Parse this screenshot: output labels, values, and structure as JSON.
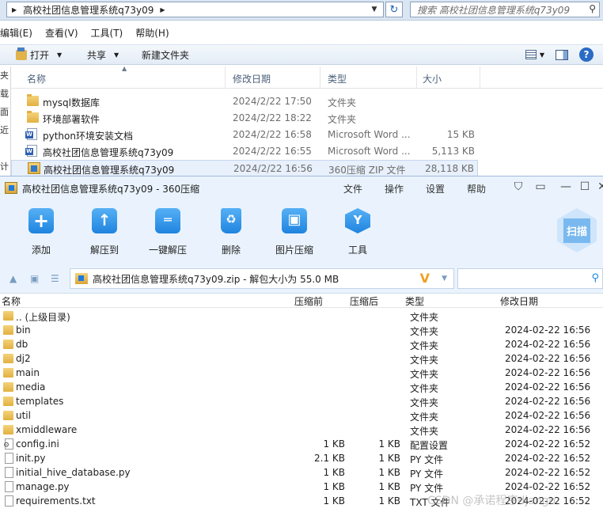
{
  "explorer": {
    "breadcrumb": "高校社团信息管理系统q73y09",
    "search_placeholder": "搜索 高校社团信息管理系统q73y09",
    "menu": [
      "编辑(E)",
      "查看(V)",
      "工具(T)",
      "帮助(H)"
    ],
    "commands": {
      "open": "打开",
      "share": "共享",
      "new_folder": "新建文件夹"
    },
    "left_strip": [
      "夹",
      "载",
      "面",
      "近访",
      "",
      "计"
    ],
    "columns": {
      "name": "名称",
      "date": "修改日期",
      "type": "类型",
      "size": "大小"
    },
    "files": [
      {
        "icon": "folder",
        "name": "mysql数据库",
        "date": "2024/2/22 17:50",
        "type": "文件夹",
        "size": ""
      },
      {
        "icon": "folder",
        "name": "环境部署软件",
        "date": "2024/2/22 18:22",
        "type": "文件夹",
        "size": ""
      },
      {
        "icon": "word",
        "name": "python环境安装文档",
        "date": "2024/2/22 16:58",
        "type": "Microsoft Word ...",
        "size": "15 KB"
      },
      {
        "icon": "word",
        "name": "高校社团信息管理系统q73y09",
        "date": "2024/2/22 16:55",
        "type": "Microsoft Word ...",
        "size": "5,113 KB"
      },
      {
        "icon": "zip",
        "name": "高校社团信息管理系统q73y09",
        "date": "2024/2/22 16:56",
        "type": "360压缩 ZIP 文件",
        "size": "28,118 KB"
      }
    ]
  },
  "zip": {
    "title": "高校社团信息管理系统q73y09 - 360压缩",
    "menu": [
      "文件",
      "操作",
      "设置",
      "帮助"
    ],
    "toolbar": [
      "添加",
      "解压到",
      "一键解压",
      "删除",
      "图片压缩",
      "工具"
    ],
    "scan_label": "扫描",
    "path": "高校社团信息管理系统q73y09.zip - 解包大小为 55.0 MB",
    "columns": {
      "name": "名称",
      "compressed": "压缩前",
      "packed": "压缩后",
      "type": "类型",
      "date": "修改日期"
    },
    "entries": [
      {
        "icon": "folder",
        "name": ".. (上级目录)",
        "compressed": "",
        "packed": "",
        "type": "文件夹",
        "date": ""
      },
      {
        "icon": "folder",
        "name": "bin",
        "compressed": "",
        "packed": "",
        "type": "文件夹",
        "date": "2024-02-22 16:56"
      },
      {
        "icon": "folder",
        "name": "db",
        "compressed": "",
        "packed": "",
        "type": "文件夹",
        "date": "2024-02-22 16:56"
      },
      {
        "icon": "folder",
        "name": "dj2",
        "compressed": "",
        "packed": "",
        "type": "文件夹",
        "date": "2024-02-22 16:56"
      },
      {
        "icon": "folder",
        "name": "main",
        "compressed": "",
        "packed": "",
        "type": "文件夹",
        "date": "2024-02-22 16:56"
      },
      {
        "icon": "folder",
        "name": "media",
        "compressed": "",
        "packed": "",
        "type": "文件夹",
        "date": "2024-02-22 16:56"
      },
      {
        "icon": "folder",
        "name": "templates",
        "compressed": "",
        "packed": "",
        "type": "文件夹",
        "date": "2024-02-22 16:56"
      },
      {
        "icon": "folder",
        "name": "util",
        "compressed": "",
        "packed": "",
        "type": "文件夹",
        "date": "2024-02-22 16:56"
      },
      {
        "icon": "folder",
        "name": "xmiddleware",
        "compressed": "",
        "packed": "",
        "type": "文件夹",
        "date": "2024-02-22 16:56"
      },
      {
        "icon": "cfg",
        "name": "config.ini",
        "compressed": "1 KB",
        "packed": "1 KB",
        "type": "配置设置",
        "date": "2024-02-22 16:52"
      },
      {
        "icon": "file",
        "name": "init.py",
        "compressed": "2.1 KB",
        "packed": "1 KB",
        "type": "PY 文件",
        "date": "2024-02-22 16:52"
      },
      {
        "icon": "file",
        "name": "initial_hive_database.py",
        "compressed": "1 KB",
        "packed": "1 KB",
        "type": "PY 文件",
        "date": "2024-02-22 16:52"
      },
      {
        "icon": "file",
        "name": "manage.py",
        "compressed": "1 KB",
        "packed": "1 KB",
        "type": "PY 文件",
        "date": "2024-02-22 16:52"
      },
      {
        "icon": "file",
        "name": "requirements.txt",
        "compressed": "1 KB",
        "packed": "1 KB",
        "type": "TXT 文件",
        "date": "2024-02-22 16:52"
      }
    ]
  },
  "watermark": "CSDN @承诺程序django"
}
